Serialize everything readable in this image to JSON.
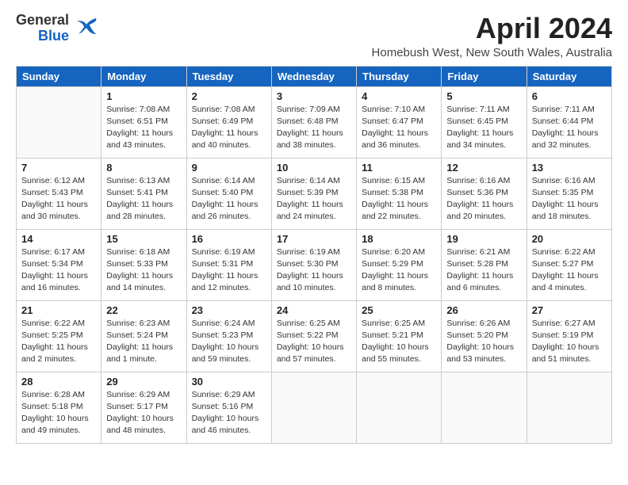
{
  "header": {
    "logo_general": "General",
    "logo_blue": "Blue",
    "month_title": "April 2024",
    "subtitle": "Homebush West, New South Wales, Australia"
  },
  "weekdays": [
    "Sunday",
    "Monday",
    "Tuesday",
    "Wednesday",
    "Thursday",
    "Friday",
    "Saturday"
  ],
  "weeks": [
    [
      {
        "day": "",
        "info": ""
      },
      {
        "day": "1",
        "info": "Sunrise: 7:08 AM\nSunset: 6:51 PM\nDaylight: 11 hours\nand 43 minutes."
      },
      {
        "day": "2",
        "info": "Sunrise: 7:08 AM\nSunset: 6:49 PM\nDaylight: 11 hours\nand 40 minutes."
      },
      {
        "day": "3",
        "info": "Sunrise: 7:09 AM\nSunset: 6:48 PM\nDaylight: 11 hours\nand 38 minutes."
      },
      {
        "day": "4",
        "info": "Sunrise: 7:10 AM\nSunset: 6:47 PM\nDaylight: 11 hours\nand 36 minutes."
      },
      {
        "day": "5",
        "info": "Sunrise: 7:11 AM\nSunset: 6:45 PM\nDaylight: 11 hours\nand 34 minutes."
      },
      {
        "day": "6",
        "info": "Sunrise: 7:11 AM\nSunset: 6:44 PM\nDaylight: 11 hours\nand 32 minutes."
      }
    ],
    [
      {
        "day": "7",
        "info": "Sunrise: 6:12 AM\nSunset: 5:43 PM\nDaylight: 11 hours\nand 30 minutes."
      },
      {
        "day": "8",
        "info": "Sunrise: 6:13 AM\nSunset: 5:41 PM\nDaylight: 11 hours\nand 28 minutes."
      },
      {
        "day": "9",
        "info": "Sunrise: 6:14 AM\nSunset: 5:40 PM\nDaylight: 11 hours\nand 26 minutes."
      },
      {
        "day": "10",
        "info": "Sunrise: 6:14 AM\nSunset: 5:39 PM\nDaylight: 11 hours\nand 24 minutes."
      },
      {
        "day": "11",
        "info": "Sunrise: 6:15 AM\nSunset: 5:38 PM\nDaylight: 11 hours\nand 22 minutes."
      },
      {
        "day": "12",
        "info": "Sunrise: 6:16 AM\nSunset: 5:36 PM\nDaylight: 11 hours\nand 20 minutes."
      },
      {
        "day": "13",
        "info": "Sunrise: 6:16 AM\nSunset: 5:35 PM\nDaylight: 11 hours\nand 18 minutes."
      }
    ],
    [
      {
        "day": "14",
        "info": "Sunrise: 6:17 AM\nSunset: 5:34 PM\nDaylight: 11 hours\nand 16 minutes."
      },
      {
        "day": "15",
        "info": "Sunrise: 6:18 AM\nSunset: 5:33 PM\nDaylight: 11 hours\nand 14 minutes."
      },
      {
        "day": "16",
        "info": "Sunrise: 6:19 AM\nSunset: 5:31 PM\nDaylight: 11 hours\nand 12 minutes."
      },
      {
        "day": "17",
        "info": "Sunrise: 6:19 AM\nSunset: 5:30 PM\nDaylight: 11 hours\nand 10 minutes."
      },
      {
        "day": "18",
        "info": "Sunrise: 6:20 AM\nSunset: 5:29 PM\nDaylight: 11 hours\nand 8 minutes."
      },
      {
        "day": "19",
        "info": "Sunrise: 6:21 AM\nSunset: 5:28 PM\nDaylight: 11 hours\nand 6 minutes."
      },
      {
        "day": "20",
        "info": "Sunrise: 6:22 AM\nSunset: 5:27 PM\nDaylight: 11 hours\nand 4 minutes."
      }
    ],
    [
      {
        "day": "21",
        "info": "Sunrise: 6:22 AM\nSunset: 5:25 PM\nDaylight: 11 hours\nand 2 minutes."
      },
      {
        "day": "22",
        "info": "Sunrise: 6:23 AM\nSunset: 5:24 PM\nDaylight: 11 hours\nand 1 minute."
      },
      {
        "day": "23",
        "info": "Sunrise: 6:24 AM\nSunset: 5:23 PM\nDaylight: 10 hours\nand 59 minutes."
      },
      {
        "day": "24",
        "info": "Sunrise: 6:25 AM\nSunset: 5:22 PM\nDaylight: 10 hours\nand 57 minutes."
      },
      {
        "day": "25",
        "info": "Sunrise: 6:25 AM\nSunset: 5:21 PM\nDaylight: 10 hours\nand 55 minutes."
      },
      {
        "day": "26",
        "info": "Sunrise: 6:26 AM\nSunset: 5:20 PM\nDaylight: 10 hours\nand 53 minutes."
      },
      {
        "day": "27",
        "info": "Sunrise: 6:27 AM\nSunset: 5:19 PM\nDaylight: 10 hours\nand 51 minutes."
      }
    ],
    [
      {
        "day": "28",
        "info": "Sunrise: 6:28 AM\nSunset: 5:18 PM\nDaylight: 10 hours\nand 49 minutes."
      },
      {
        "day": "29",
        "info": "Sunrise: 6:29 AM\nSunset: 5:17 PM\nDaylight: 10 hours\nand 48 minutes."
      },
      {
        "day": "30",
        "info": "Sunrise: 6:29 AM\nSunset: 5:16 PM\nDaylight: 10 hours\nand 46 minutes."
      },
      {
        "day": "",
        "info": ""
      },
      {
        "day": "",
        "info": ""
      },
      {
        "day": "",
        "info": ""
      },
      {
        "day": "",
        "info": ""
      }
    ]
  ]
}
